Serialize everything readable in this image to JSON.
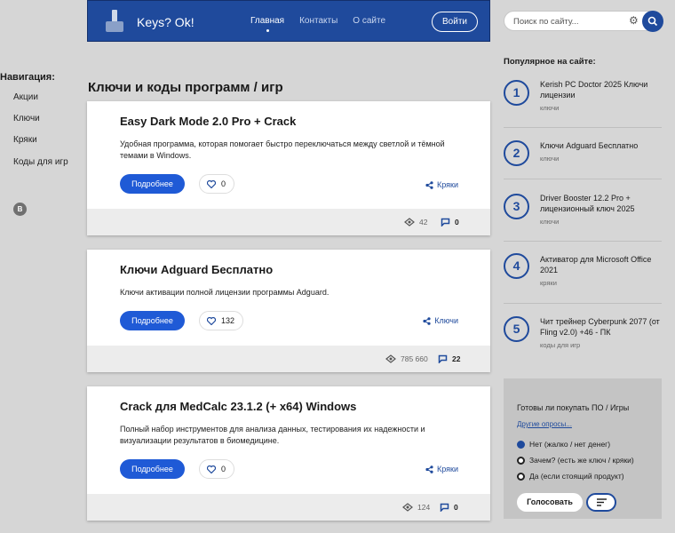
{
  "header": {
    "title": "Keys? Ok!",
    "nav": [
      "Главная",
      "Контакты",
      "О сайте"
    ],
    "login_label": "Войти"
  },
  "search": {
    "placeholder": "Поиск по сайту..."
  },
  "sidebar": {
    "title": "Навигация:",
    "items": [
      "Акции",
      "Ключи",
      "Кряки",
      "Коды для игр"
    ],
    "vk_letter": "B"
  },
  "main": {
    "title": "Ключи и коды программ / игр",
    "more_label": "Подробнее",
    "cards": [
      {
        "title": "Easy Dark Mode 2.0 Pro + Crack",
        "desc": "Удобная программа, которая помогает быстро переключаться между светлой и тёмной темами в Windows.",
        "likes": "0",
        "tag": "Кряки",
        "views": "42",
        "comments": "0"
      },
      {
        "title": "Ключи Adguard Бесплатно",
        "desc": "Ключи активации полной лицензии программы Adguard.",
        "likes": "132",
        "tag": "Ключи",
        "views": "785 660",
        "comments": "22"
      },
      {
        "title": "Crack для MedCalc 23.1.2 (+ x64) Windows",
        "desc": "Полный набор инструментов для анализа данных, тестирования их надежности и визуализации результатов в биомедицине.",
        "likes": "0",
        "tag": "Кряки",
        "views": "124",
        "comments": "0"
      }
    ]
  },
  "popular": {
    "title": "Популярное на сайте:",
    "items": [
      {
        "num": "1",
        "title": "Kerish PC Doctor 2025 Ключи лицензии",
        "cat": "ключи"
      },
      {
        "num": "2",
        "title": "Ключи Adguard Бесплатно",
        "cat": "ключи"
      },
      {
        "num": "3",
        "title": "Driver Booster 12.2 Pro + лицензионный ключ 2025",
        "cat": "ключи"
      },
      {
        "num": "4",
        "title": "Активатор для Microsoft Office 2021",
        "cat": "кряки"
      },
      {
        "num": "5",
        "title": "Чит трейнер Cyberpunk 2077 (от Fling v2.0) +46 - ПК",
        "cat": "коды для игр"
      }
    ]
  },
  "poll": {
    "question": "Готовы ли покупать ПО / Игры",
    "other_link": "Другие опросы...",
    "options": [
      "Нет (жалко / нет денег)",
      "Зачем? (есть же ключ / кряки)",
      "Да (если стоящий продукт)"
    ],
    "vote_label": "Голосовать"
  },
  "colors": {
    "brand": "#1f4a9c",
    "button": "#1f5ad6",
    "background": "#d6d6d6"
  }
}
